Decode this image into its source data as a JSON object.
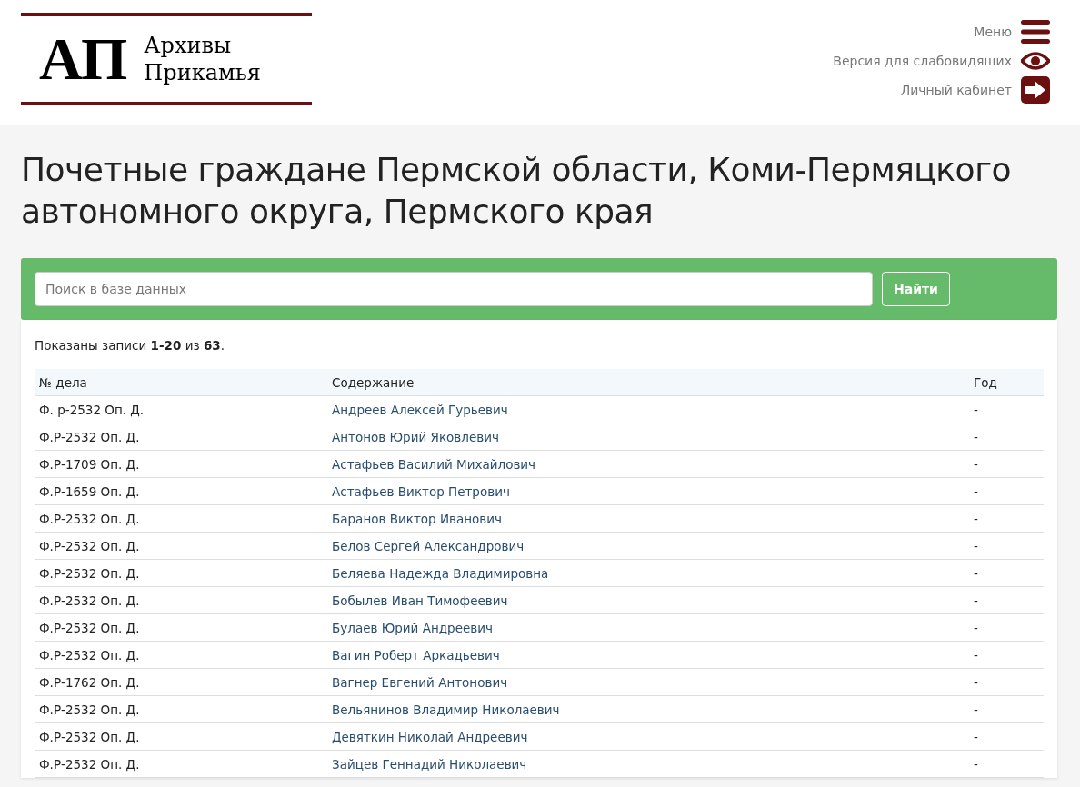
{
  "logo": {
    "mark": "АП",
    "lines": [
      "Архивы",
      "Прикамья"
    ]
  },
  "nav": [
    {
      "kind": "menu",
      "label": "Меню"
    },
    {
      "kind": "eye",
      "label": "Версия для слабовидящих"
    },
    {
      "kind": "login",
      "label": "Личный кабинет"
    }
  ],
  "title": "Почетные граждане Пермской области, Коми-Пермяцкого автономного округа, Пермского края",
  "search": {
    "placeholder": "Поиск в базе данных",
    "button": "Найти"
  },
  "summary": "Показаны записи **1-20** из **63**.",
  "table": {
    "columns": [
      "№ дела",
      "Содержание",
      "Год"
    ],
    "rows": [
      [
        "Ф. р-2532 Оп. Д.",
        "Андреев Алексей Гурьевич",
        "-"
      ],
      [
        "Ф.Р-2532 Оп. Д.",
        "Антонов Юрий Яковлевич",
        "-"
      ],
      [
        "Ф.Р-1709 Оп. Д.",
        "Астафьев Василий Михайлович",
        "-"
      ],
      [
        "Ф.Р-1659 Оп. Д.",
        "Астафьев Виктор Петрович",
        "-"
      ],
      [
        "Ф.Р-2532 Оп. Д.",
        "Баранов Виктор Иванович",
        "-"
      ],
      [
        "Ф.Р-2532 Оп. Д.",
        "Белов Сергей Александрович",
        "-"
      ],
      [
        "Ф.Р-2532 Оп. Д.",
        "Беляева Надежда Владимировна",
        "-"
      ],
      [
        "Ф.Р-2532 Оп. Д.",
        "Бобылев Иван Тимофеевич",
        "-"
      ],
      [
        "Ф.Р-2532 Оп. Д.",
        "Булаев Юрий Андреевич",
        "-"
      ],
      [
        "Ф.Р-2532 Оп. Д.",
        "Вагин Роберт Аркадьевич",
        "-"
      ],
      [
        "Ф.Р-1762 Оп. Д.",
        "Вагнер Евгений Антонович",
        "-"
      ],
      [
        "Ф.Р-2532 Оп. Д.",
        "Вельянинов Владимир Николаевич",
        "-"
      ],
      [
        "Ф.Р-2532 Оп. Д.",
        "Девяткин Николай Андреевич",
        "-"
      ],
      [
        "Ф.Р-2532 Оп. Д.",
        "Зайцев Геннадий Николаевич",
        "-"
      ]
    ]
  }
}
